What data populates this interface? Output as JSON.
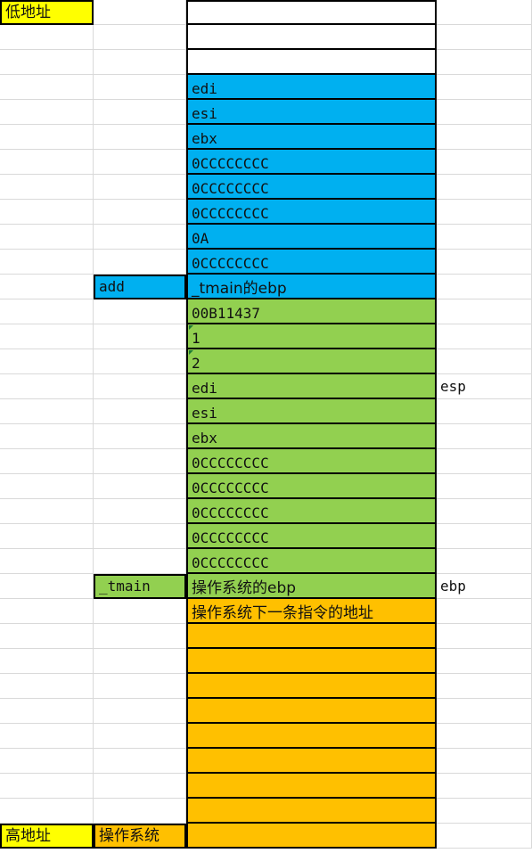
{
  "colors": {
    "yellow": "#ffff00",
    "blue": "#00b0f0",
    "green": "#92d050",
    "orange": "#ffc000",
    "white": "#ffffff"
  },
  "labels": {
    "low_address": "低地址",
    "high_address": "高地址",
    "os": "操作系统"
  },
  "stack": [
    {
      "text": "",
      "color": "white"
    },
    {
      "text": "",
      "color": "white"
    },
    {
      "text": "",
      "color": "white"
    },
    {
      "text": "edi",
      "color": "blue"
    },
    {
      "text": "esi",
      "color": "blue"
    },
    {
      "text": "ebx",
      "color": "blue"
    },
    {
      "text": "0CCCCCCCC",
      "color": "blue"
    },
    {
      "text": "0CCCCCCCC",
      "color": "blue"
    },
    {
      "text": "0CCCCCCCC",
      "color": "blue"
    },
    {
      "text": "0A",
      "color": "blue"
    },
    {
      "text": "0CCCCCCCC",
      "color": "blue"
    },
    {
      "text": "_tmain的ebp",
      "color": "blue",
      "frame": "add"
    },
    {
      "text": "00B11437",
      "color": "green"
    },
    {
      "text": "1",
      "color": "green",
      "tick": true
    },
    {
      "text": "2",
      "color": "green",
      "tick": true
    },
    {
      "text": "edi",
      "color": "green",
      "pointer": "esp"
    },
    {
      "text": "esi",
      "color": "green"
    },
    {
      "text": "ebx",
      "color": "green"
    },
    {
      "text": "0CCCCCCCC",
      "color": "green"
    },
    {
      "text": "0CCCCCCCC",
      "color": "green"
    },
    {
      "text": "0CCCCCCCC",
      "color": "green"
    },
    {
      "text": "0CCCCCCCC",
      "color": "green"
    },
    {
      "text": "0CCCCCCCC",
      "color": "green"
    },
    {
      "text": "操作系统的ebp",
      "color": "green",
      "frame": "_tmain",
      "pointer": "ebp"
    },
    {
      "text": "操作系统下一条指令的地址",
      "color": "orange"
    },
    {
      "text": "",
      "color": "orange"
    },
    {
      "text": "",
      "color": "orange"
    },
    {
      "text": "",
      "color": "orange"
    },
    {
      "text": "",
      "color": "orange"
    },
    {
      "text": "",
      "color": "orange"
    },
    {
      "text": "",
      "color": "orange"
    },
    {
      "text": "",
      "color": "orange"
    },
    {
      "text": "",
      "color": "orange"
    },
    {
      "text": "",
      "color": "orange"
    }
  ]
}
